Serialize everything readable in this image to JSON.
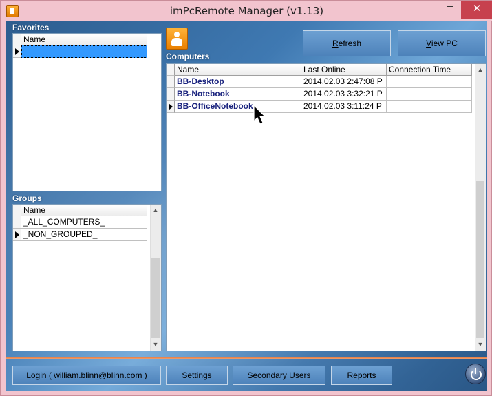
{
  "window": {
    "title": "imPcRemote Manager (v1.13)",
    "min_glyph": "—",
    "close_glyph": "✕"
  },
  "favorites": {
    "label": "Favorites",
    "column": "Name",
    "rows": [
      ""
    ]
  },
  "groups": {
    "label": "Groups",
    "column": "Name",
    "rows": [
      "_ALL_COMPUTERS_",
      "_NON_GROUPED_"
    ]
  },
  "computers": {
    "label": "Computers",
    "columns": [
      "Name",
      "Last Online",
      "Connection Time"
    ],
    "rows": [
      {
        "name": "BB-Desktop",
        "last_online": "2014.02.03 2:47:08 P",
        "connection_time": ""
      },
      {
        "name": "BB-Notebook",
        "last_online": "2014.02.03 3:32:21 P",
        "connection_time": ""
      },
      {
        "name": "BB-OfficeNotebook",
        "last_online": "2014.02.03 3:11:24 P",
        "connection_time": ""
      }
    ]
  },
  "toolbar": {
    "refresh_pre": "",
    "refresh_key": "R",
    "refresh_post": "efresh",
    "view_pre": "",
    "view_key": "V",
    "view_post": "iew PC"
  },
  "footer": {
    "login_pre": "",
    "login_key": "L",
    "login_post": "ogin ( william.blinn@blinn.com )",
    "settings_pre": "",
    "settings_key": "S",
    "settings_post": "ettings",
    "secondary_pre": "Secondary ",
    "secondary_key": "U",
    "secondary_post": "sers",
    "reports_pre": "",
    "reports_key": "R",
    "reports_post": "eports"
  },
  "colors": {
    "accent": "#4d82ba",
    "selection": "#3399ff",
    "computer_name": "#1a237e",
    "separator": "#e06a2b"
  },
  "icons": [
    "app-icon",
    "person-icon",
    "power-icon",
    "row-pointer-icon",
    "mouse-cursor-icon"
  ]
}
